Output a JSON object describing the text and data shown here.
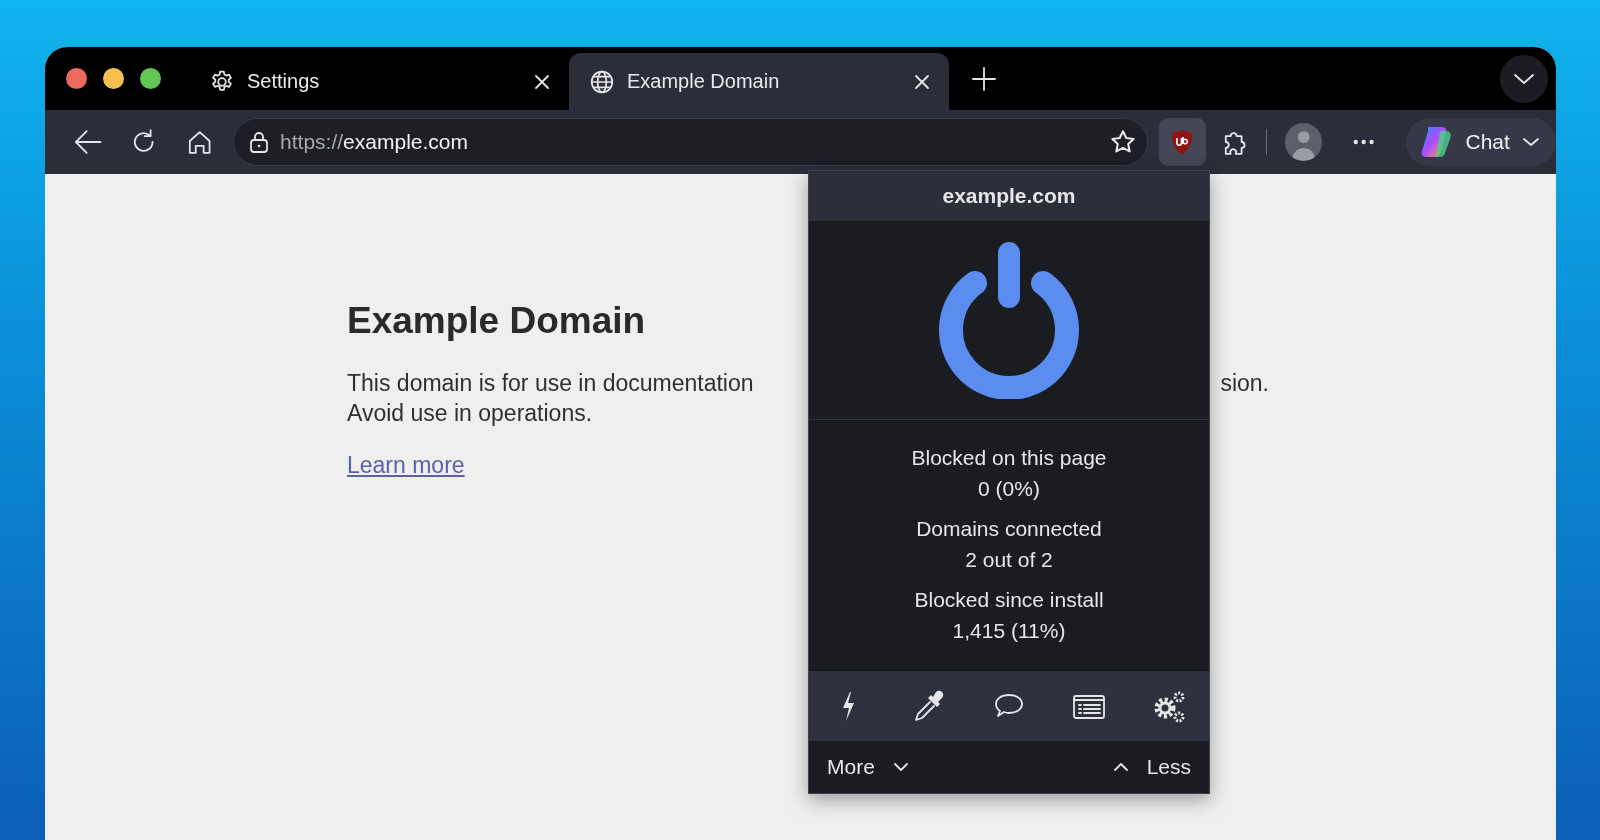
{
  "tabs": [
    {
      "kind": "settings",
      "label": "Settings",
      "selected": false
    },
    {
      "kind": "web",
      "label": "Example Domain",
      "selected": true
    }
  ],
  "address_bar": {
    "scheme": "https://",
    "host": "example.com"
  },
  "chat_button": {
    "label": "Chat"
  },
  "page": {
    "heading": "Example Domain",
    "paragraph_left": "This domain is for use in documentation",
    "paragraph_right": "sion.",
    "paragraph_line_2": "Avoid use in operations.",
    "link": "Learn more"
  },
  "popup": {
    "hostname": "example.com",
    "power_on": true,
    "stats": [
      {
        "label": "Blocked on this page",
        "value": "0 (0%)"
      },
      {
        "label": "Domains connected",
        "value": "2 out of 2"
      },
      {
        "label": "Blocked since install",
        "value": "1,415 (11%)"
      }
    ],
    "more": "More",
    "less": "Less"
  }
}
